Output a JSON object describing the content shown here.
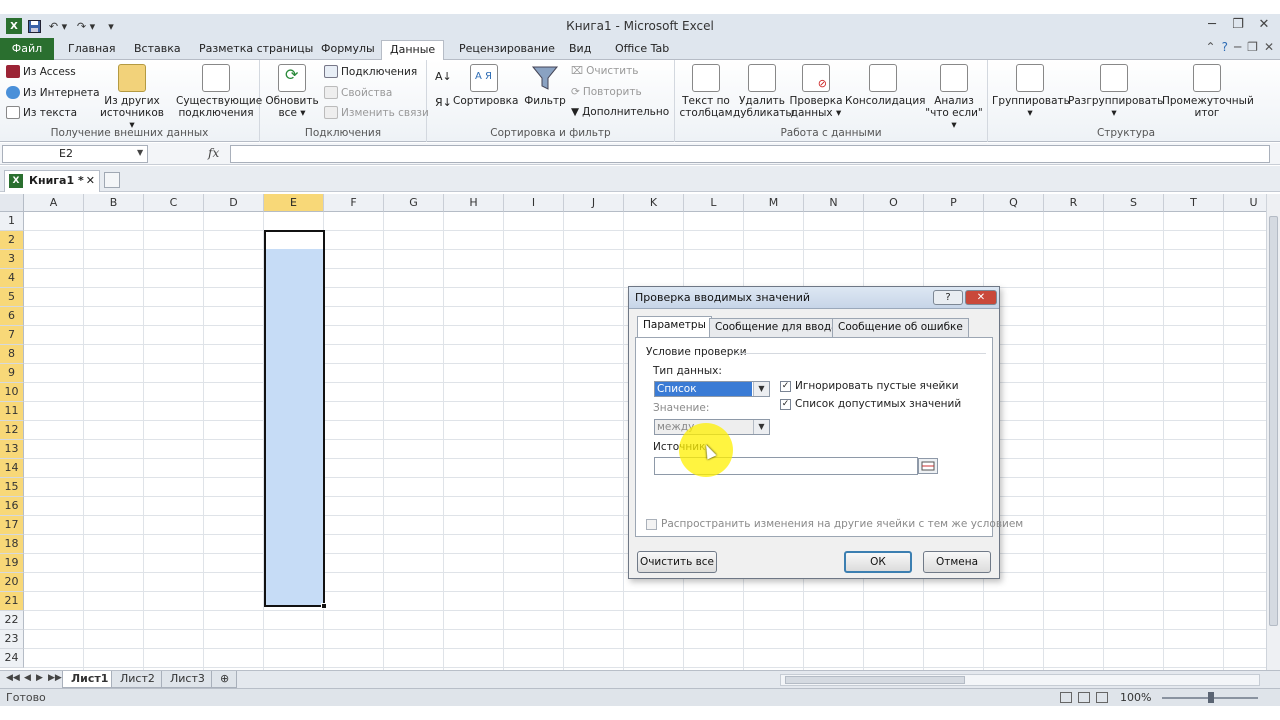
{
  "window": {
    "title": "Книга1  -  Microsoft Excel",
    "qat": {
      "save_icon": "save-icon",
      "undo_icon": "undo-icon",
      "redo_icon": "redo-icon"
    }
  },
  "ribbon_tabs": [
    {
      "label": "Файл"
    },
    {
      "label": "Главная"
    },
    {
      "label": "Вставка"
    },
    {
      "label": "Разметка страницы"
    },
    {
      "label": "Формулы"
    },
    {
      "label": "Данные"
    },
    {
      "label": "Рецензирование"
    },
    {
      "label": "Вид"
    },
    {
      "label": "Office Tab"
    }
  ],
  "ribbon": {
    "external_data": {
      "from_access": "Из Access",
      "from_web": "Из Интернета",
      "from_text": "Из текста",
      "from_other_1": "Из других",
      "from_other_2": "источников ▾",
      "existing_1": "Существующие",
      "existing_2": "подключения",
      "label": "Получение внешних данных"
    },
    "connections": {
      "refresh_1": "Обновить",
      "refresh_2": "все ▾",
      "connections": "Подключения",
      "properties": "Свойства",
      "edit_links": "Изменить связи",
      "label": "Подключения"
    },
    "sort_filter": {
      "sort": "Сортировка",
      "filter": "Фильтр",
      "clear": "Очистить",
      "reapply": "Повторить",
      "advanced": "Дополнительно",
      "label": "Сортировка и фильтр"
    },
    "data_tools": {
      "text_to_cols_1": "Текст по",
      "text_to_cols_2": "столбцам",
      "remove_dup_1": "Удалить",
      "remove_dup_2": "дубликаты",
      "validation_1": "Проверка",
      "validation_2": "данных ▾",
      "consolidate": "Консолидация",
      "whatif_1": "Анализ",
      "whatif_2": "\"что если\" ▾",
      "label": "Работа с данными"
    },
    "outline": {
      "group": "Группировать",
      "ungroup": "Разгруппировать",
      "subtotal_1": "Промежуточный",
      "subtotal_2": "итог",
      "label": "Структура"
    }
  },
  "formula_bar": {
    "name_box": "E2",
    "fx": "fx",
    "value": ""
  },
  "doc_tab": {
    "label": "Книга1 *"
  },
  "sheet": {
    "columns": [
      "A",
      "B",
      "C",
      "D",
      "E",
      "F",
      "G",
      "H",
      "I",
      "J",
      "K",
      "L",
      "M",
      "N",
      "O",
      "P",
      "Q",
      "R",
      "S",
      "T",
      "U"
    ],
    "rows": [
      "1",
      "2",
      "3",
      "4",
      "5",
      "6",
      "7",
      "8",
      "9",
      "10",
      "11",
      "12",
      "13",
      "14",
      "15",
      "16",
      "17",
      "18",
      "19",
      "20",
      "21",
      "22",
      "23",
      "24"
    ]
  },
  "sheet_tabs": [
    "Лист1",
    "Лист2",
    "Лист3"
  ],
  "status": {
    "text": "Готово",
    "zoom": "100%"
  },
  "dialog": {
    "title": "Проверка вводимых значений",
    "tabs": [
      "Параметры",
      "Сообщение для ввода",
      "Сообщение об ошибке"
    ],
    "section": "Условие проверки",
    "data_type_label": "Тип данных:",
    "data_type_value": "Список",
    "value_label": "Значение:",
    "value_value": "между",
    "ignore_blank": "Игнорировать пустые ячейки",
    "in_cell_dropdown": "Список допустимых значений",
    "source_label": "Источник:",
    "apply_all": "Распространить изменения на другие ячейки с тем же условием",
    "clear_all": "Очистить все",
    "ok": "ОК",
    "cancel": "Отмена"
  }
}
